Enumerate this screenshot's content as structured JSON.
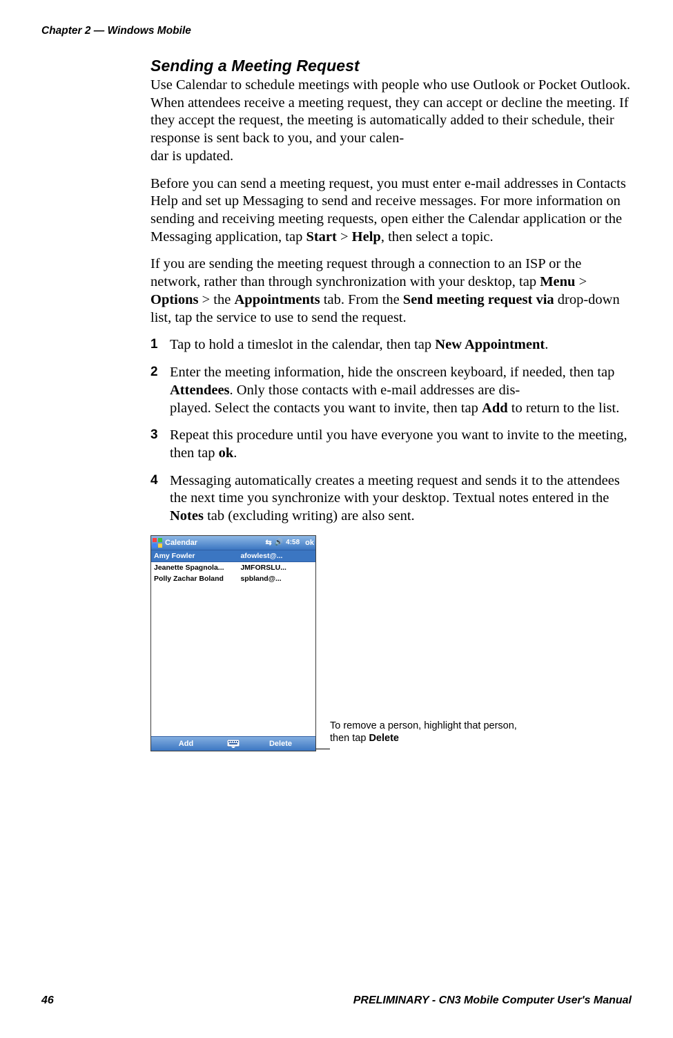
{
  "header": {
    "running_head": "Chapter 2 — Windows Mobile"
  },
  "section": {
    "title": "Sending a Meeting Request",
    "para1_a": "Use Calendar to schedule meetings with people who use Outlook or Pocket Outlook. When attendees receive a meeting request, they can accept or decline the meeting. If they accept the request, the meeting is automatically added to their schedule, their response is sent back to you, and your calen",
    "para1_a_hyph": "-",
    "para1_b": "dar is updated.",
    "para2_a": "Before you can send a meeting request, you must enter e-mail addresses in Contacts Help and set up Messaging to send and receive messages. For more information on sending and receiving meeting requests, open either the Calendar application or the Messaging application, tap",
    "para2_start": " Start",
    "para2_gt1": " > ",
    "para2_help": "Help",
    "para2_end": ", then select a topic.",
    "para3_a": "If you are sending the meeting request through a connection to an ISP or the network, rather than through synchronization with your desktop, tap ",
    "para3_menu": "Menu",
    "para3_gt1": " > ",
    "para3_options": "Options",
    "para3_gt2": " > the ",
    "para3_appt": "Appointments",
    "para3_mid": " tab. From the ",
    "para3_send": "Send meeting request via",
    "para3_end": " drop-down list, tap the service to use to send the request."
  },
  "steps": {
    "s1_a": "Tap to hold a timeslot in the calendar, then tap ",
    "s1_b": "New Appointment",
    "s1_c": ".",
    "s2_a": "Enter the meeting information, hide the onscreen keyboard, if needed, then tap ",
    "s2_b": "Attendees",
    "s2_c": ". Only those contacts with e-mail addresses are dis",
    "s2_c_hyph": "-",
    "s2_d": "played. Select the contacts you want to invite, then tap ",
    "s2_e": "Add",
    "s2_f": " to return to the list.",
    "s3_a": "Repeat this procedure until you have everyone you want to invite to the meeting, then tap ",
    "s3_b": "ok",
    "s3_c": ".",
    "s4_a": "Messaging automatically creates a meeting request and sends it to the attendees the next time you synchronize with your desktop. Textual notes entered in the ",
    "s4_b": "Notes",
    "s4_c": " tab (excluding writing) are also sent."
  },
  "mock": {
    "app_title": "Calendar",
    "time": "4:58",
    "ok": "ok",
    "selected": {
      "name": "Amy Fowler",
      "email": "afowlest@..."
    },
    "rows": [
      {
        "name": "Jeanette Spagnola...",
        "email": "JMFORSLU..."
      },
      {
        "name": "Polly Zachar Boland",
        "email": "spbland@..."
      }
    ],
    "soft_left": "Add",
    "soft_right": "Delete"
  },
  "callout": {
    "line1": "To remove a person, highlight that person,",
    "line2_a": "then tap ",
    "line2_b": "Delete"
  },
  "footer": {
    "page_num": "46",
    "right": "PRELIMINARY - CN3 Mobile Computer User's Manual"
  }
}
